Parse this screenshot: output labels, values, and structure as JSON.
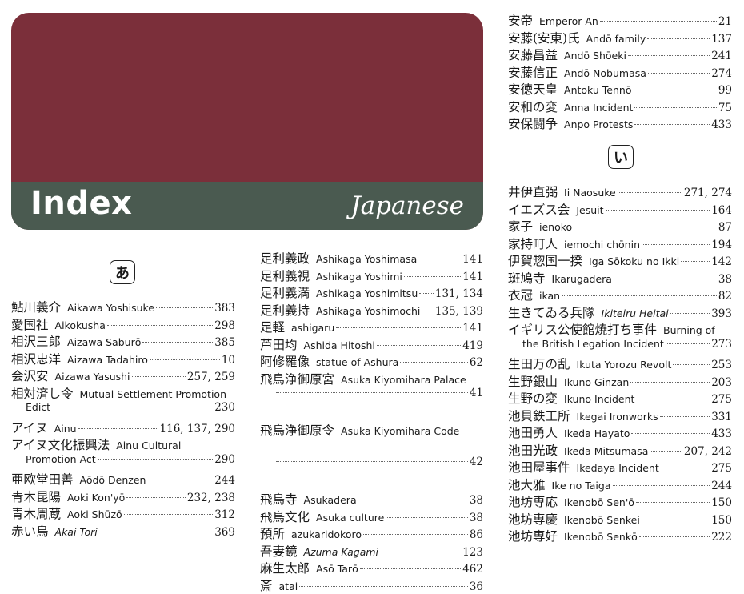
{
  "banner": {
    "title": "Index",
    "subtitle": "Japanese"
  },
  "headings": {
    "a": "あ",
    "i": "い"
  },
  "col1": [
    {
      "jp": "鮎川義介",
      "en": "Aikawa Yoshisuke",
      "pg": "383"
    },
    {
      "jp": "愛国社",
      "en": "Aikokusha",
      "pg": "298"
    },
    {
      "jp": "相沢三郎",
      "en": "Aizawa Saburō",
      "pg": "385"
    },
    {
      "jp": "相沢忠洋",
      "en": "Aizawa Tadahiro",
      "pg": "10"
    },
    {
      "jp": "会沢安",
      "en": "Aizawa Yasushi",
      "pg": "257, 259"
    },
    {
      "jp": "相対済し令",
      "en": "Mutual Settlement Promotion",
      "pg": ""
    },
    {
      "jp": "",
      "en": "Edict",
      "pg": "230",
      "cont": true
    },
    {
      "jp": "アイヌ",
      "en": "Ainu",
      "pg": "116, 137, 290"
    },
    {
      "jp": "アイヌ文化振興法",
      "en": "Ainu Cultural",
      "pg": ""
    },
    {
      "jp": "",
      "en": "Promotion Act",
      "pg": "290",
      "cont": true
    },
    {
      "jp": "亜欧堂田善",
      "en": "Aōdō Denzen",
      "pg": "244"
    },
    {
      "jp": "青木昆陽",
      "en": "Aoki Kon'yō",
      "pg": "232, 238"
    },
    {
      "jp": "青木周蔵",
      "en": "Aoki Shūzō",
      "pg": "312"
    },
    {
      "jp": "赤い鳥",
      "en": "Akai Tori",
      "pg": "369",
      "it": true
    }
  ],
  "col2": [
    {
      "jp": "足利義政",
      "en": "Ashikaga Yoshimasa",
      "pg": "141"
    },
    {
      "jp": "足利義視",
      "en": "Ashikaga Yoshimi",
      "pg": "141"
    },
    {
      "jp": "足利義満",
      "en": "Ashikaga Yoshimitsu",
      "pg": "131, 134"
    },
    {
      "jp": "足利義持",
      "en": "Ashikaga Yoshimochi",
      "pg": "135, 139"
    },
    {
      "jp": "足軽",
      "en": "ashigaru",
      "pg": "141"
    },
    {
      "jp": "芦田均",
      "en": "Ashida Hitoshi",
      "pg": "419"
    },
    {
      "jp": "阿修羅像",
      "en": "statue of Ashura",
      "pg": "62"
    },
    {
      "jp": "飛鳥浄御原宮",
      "en": "Asuka Kiyomihara Palace",
      "pg": ""
    },
    {
      "jp": "",
      "en": "",
      "pg": "41",
      "cont": true
    },
    {
      "jp": "",
      "en": "",
      "pg": "",
      "blank": true
    },
    {
      "jp": "飛鳥浄御原令",
      "en": "Asuka Kiyomihara Code",
      "pg": ""
    },
    {
      "jp": "",
      "en": "",
      "pg": "",
      "blank": true
    },
    {
      "jp": "",
      "en": "",
      "pg": "42",
      "cont": true
    },
    {
      "jp": "",
      "en": "",
      "pg": "",
      "blank": true
    },
    {
      "jp": "飛鳥寺",
      "en": "Asukadera",
      "pg": "38"
    },
    {
      "jp": "飛鳥文化",
      "en": "Asuka culture",
      "pg": "38"
    },
    {
      "jp": "預所",
      "en": "azukaridokoro",
      "pg": "86"
    },
    {
      "jp": "吾妻鏡",
      "en": "Azuma Kagami",
      "pg": "123",
      "it": true
    },
    {
      "jp": "麻生太郎",
      "en": "Asō Tarō",
      "pg": "462"
    },
    {
      "jp": "斎",
      "en": "atai",
      "pg": "36"
    }
  ],
  "col3a": [
    {
      "jp": "安帝",
      "en": "Emperor An",
      "pg": "21"
    },
    {
      "jp": "安藤(安東)氏",
      "en": "Andō family",
      "pg": "137"
    },
    {
      "jp": "安藤昌益",
      "en": "Andō Shōeki",
      "pg": "241"
    },
    {
      "jp": "安藤信正",
      "en": "Andō Nobumasa",
      "pg": "274"
    },
    {
      "jp": "安徳天皇",
      "en": "Antoku Tennō",
      "pg": "99"
    },
    {
      "jp": "安和の変",
      "en": "Anna Incident",
      "pg": "75"
    },
    {
      "jp": "安保闘争",
      "en": "Anpo Protests",
      "pg": "433"
    }
  ],
  "col3b": [
    {
      "jp": "井伊直弼",
      "en": "Ii Naosuke",
      "pg": "271, 274"
    },
    {
      "jp": "イエズス会",
      "en": "Jesuit",
      "pg": "164"
    },
    {
      "jp": "家子",
      "en": "ienoko",
      "pg": "87"
    },
    {
      "jp": "家持町人",
      "en": "iemochi chōnin",
      "pg": "194"
    },
    {
      "jp": "伊賀惣国一揆",
      "en": "Iga Sōkoku no Ikki",
      "pg": "142"
    },
    {
      "jp": "斑鳩寺",
      "en": "Ikarugadera",
      "pg": "38"
    },
    {
      "jp": "衣冠",
      "en": "ikan",
      "pg": "82"
    },
    {
      "jp": "生きてゐる兵隊",
      "en": "Ikiteiru Heitai",
      "pg": "393",
      "it": true
    },
    {
      "jp": "イギリス公使館焼打ち事件",
      "en": "Burning of",
      "pg": ""
    },
    {
      "jp": "",
      "en": "the British Legation Incident",
      "pg": "273",
      "cont": true
    },
    {
      "jp": "生田万の乱",
      "en": "Ikuta Yorozu Revolt",
      "pg": "253"
    },
    {
      "jp": "生野銀山",
      "en": "Ikuno Ginzan",
      "pg": "203"
    },
    {
      "jp": "生野の変",
      "en": "Ikuno Incident",
      "pg": "275"
    },
    {
      "jp": "池貝鉄工所",
      "en": "Ikegai Ironworks",
      "pg": "331"
    },
    {
      "jp": "池田勇人",
      "en": "Ikeda Hayato",
      "pg": "433"
    },
    {
      "jp": "池田光政",
      "en": "Ikeda Mitsumasa",
      "pg": "207, 242"
    },
    {
      "jp": "池田屋事件",
      "en": "Ikedaya Incident",
      "pg": "275"
    },
    {
      "jp": "池大雅",
      "en": "Ike no Taiga",
      "pg": "244"
    },
    {
      "jp": "池坊専応",
      "en": "Ikenobō Sen'ō",
      "pg": "150"
    },
    {
      "jp": "池坊専慶",
      "en": "Ikenobō Senkei",
      "pg": "150"
    },
    {
      "jp": "池坊専好",
      "en": "Ikenobō Senkō",
      "pg": "222"
    }
  ]
}
